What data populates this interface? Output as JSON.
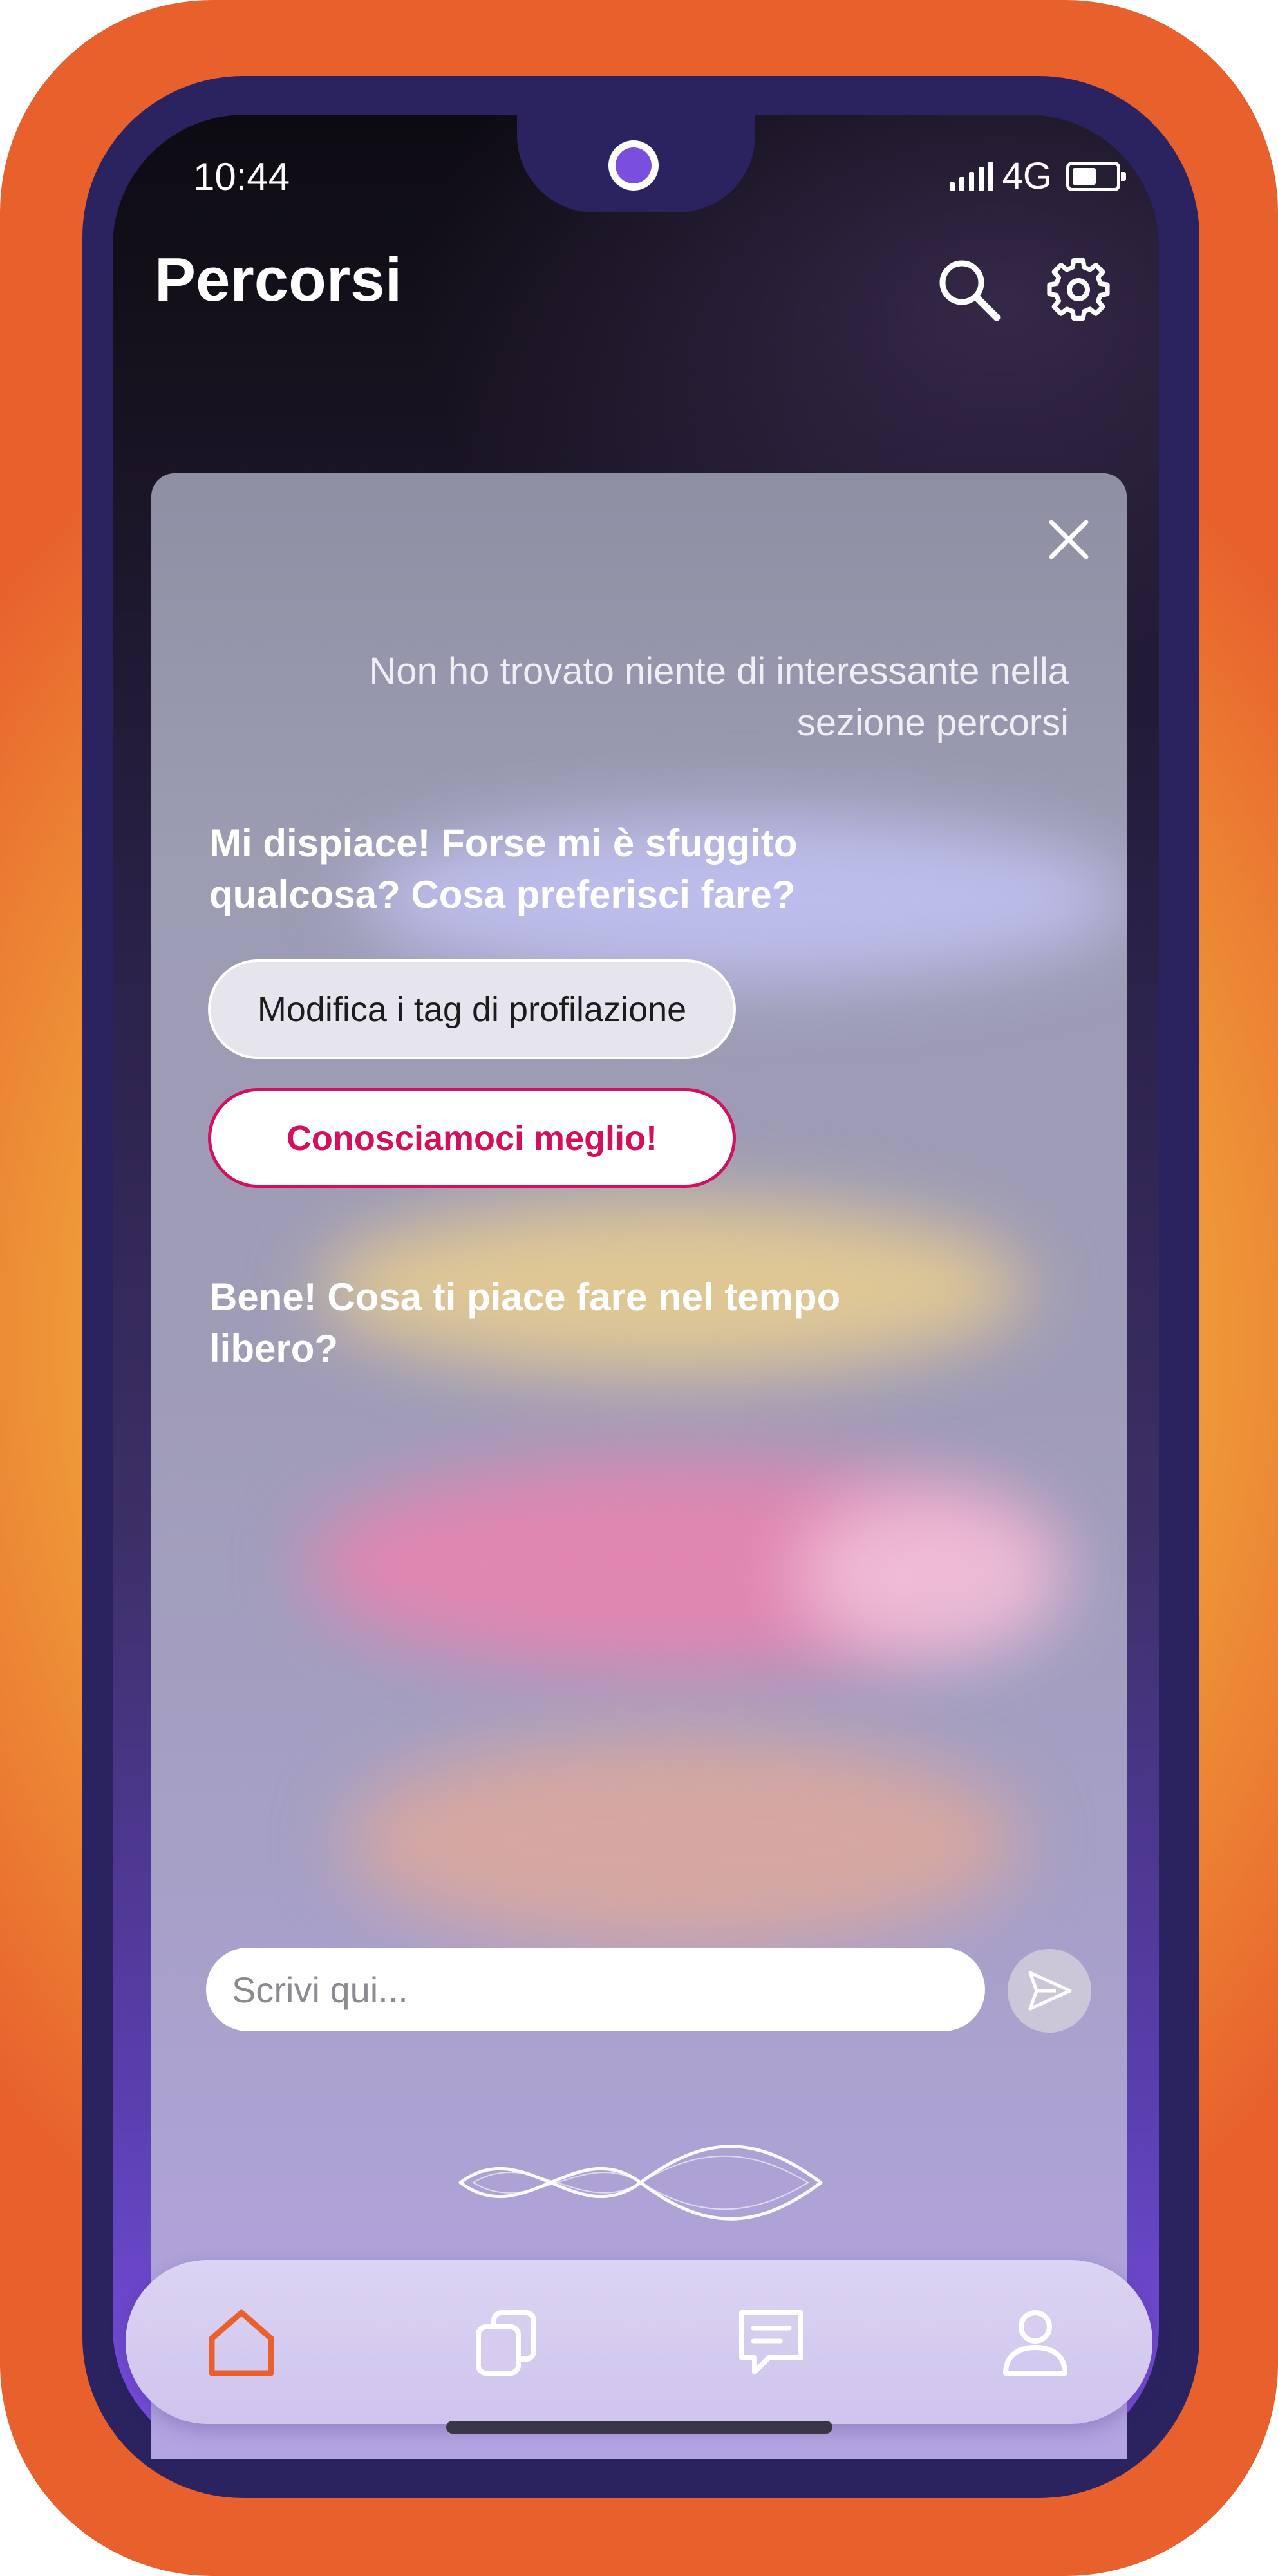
{
  "status_bar": {
    "time": "10:44",
    "network": "4G",
    "battery_level": 0.5
  },
  "header": {
    "title": "Percorsi",
    "search_icon": "search-icon",
    "settings_icon": "gear-icon"
  },
  "chat": {
    "user_message": "Non ho trovato niente di interessante nella sezione percorsi",
    "bot_message_1": "Mi dispiace! Forse mi è sfuggito qualcosa? Cosa preferisci fare?",
    "option_1": "Modifica i tag di profilazione",
    "option_2": "Conosciamoci meglio!",
    "bot_message_2": "Bene! Cosa ti piace fare nel tempo libero?",
    "input_placeholder": "Scrivi qui..."
  },
  "bottom_nav": {
    "items": [
      {
        "icon": "home-icon",
        "active": true
      },
      {
        "icon": "copy-icon",
        "active": false
      },
      {
        "icon": "chat-icon",
        "active": false
      },
      {
        "icon": "user-icon",
        "active": false
      }
    ]
  },
  "colors": {
    "frame": "#e8602c",
    "frame_glow": "#f4c444",
    "accent_pink": "#d4105d",
    "active_nav": "#e8602c",
    "nav_icon": "#ffffff"
  }
}
